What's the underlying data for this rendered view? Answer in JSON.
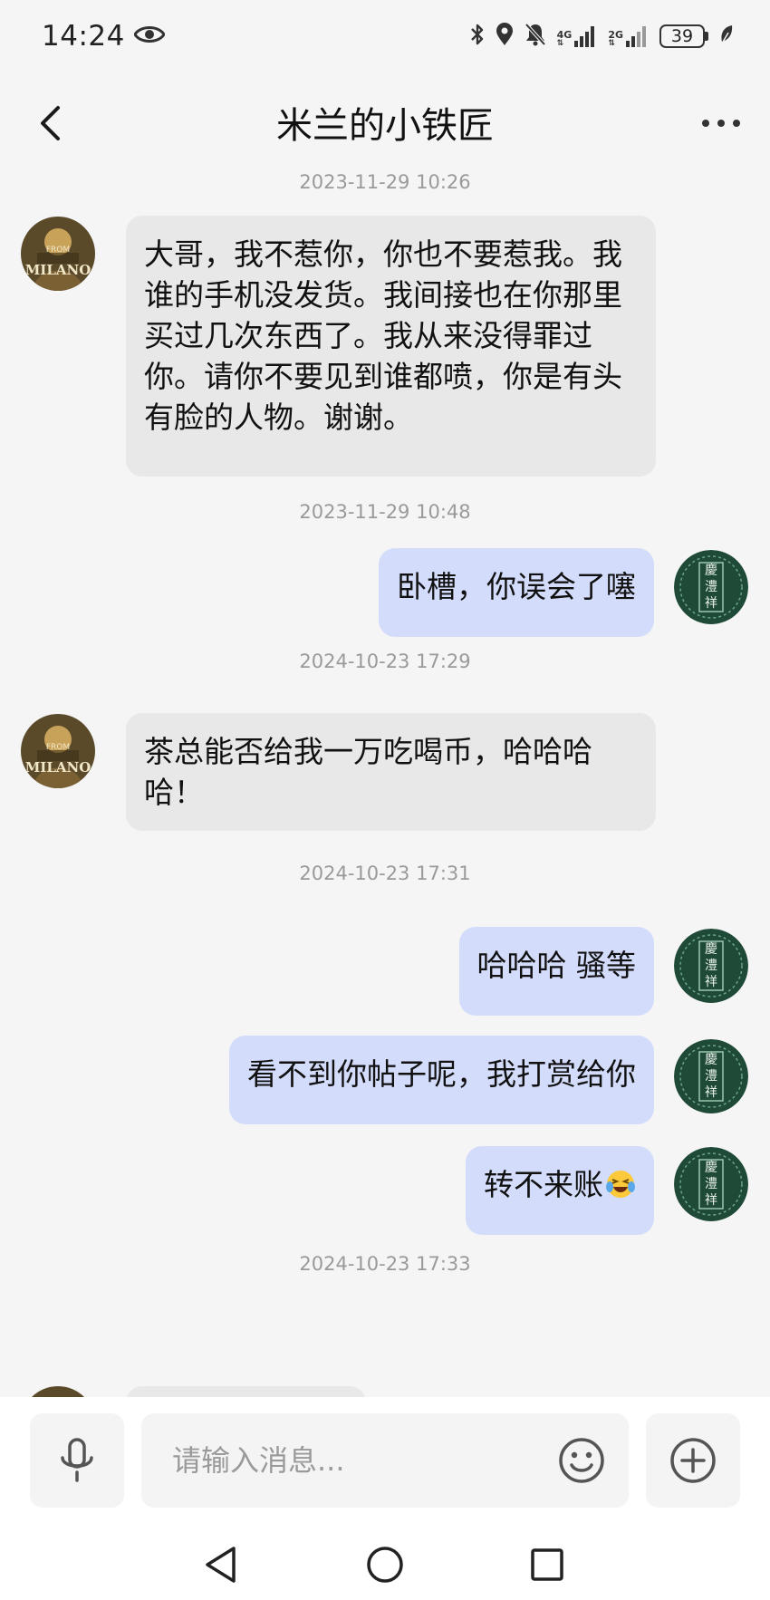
{
  "status_bar": {
    "time": "14:24",
    "net_4g": "4G",
    "net_2g": "2G",
    "battery": "39",
    "icons": [
      "eye-icon",
      "bluetooth-icon",
      "location-icon",
      "mute-icon",
      "signal-icon",
      "leaf-icon"
    ]
  },
  "header": {
    "title": "米兰的小铁匠",
    "back_icon": "chevron-left-icon",
    "more_icon": "more-dots-icon"
  },
  "messages": [
    {
      "type": "time",
      "text": "2023-11-29 10:26"
    },
    {
      "type": "in",
      "text": "大哥，我不惹你，你也不要惹我。我谁的手机没发货。我间接也在你那里买过几次东西了。我从来没得罪过你。请你不要见到谁都喷，你是有头有脸的人物。谢谢。"
    },
    {
      "type": "time",
      "text": "2023-11-29 10:48"
    },
    {
      "type": "out",
      "text": "卧槽，你误会了噻"
    },
    {
      "type": "time",
      "text": "2024-10-23 17:29"
    },
    {
      "type": "in",
      "text": "茶总能否给我一万吃喝币，哈哈哈哈！"
    },
    {
      "type": "time",
      "text": "2024-10-23 17:31"
    },
    {
      "type": "out",
      "text": "哈哈哈 骚等"
    },
    {
      "type": "out",
      "text": "看不到你帖子呢，我打赏给你"
    },
    {
      "type": "out",
      "text": "转不来账",
      "emoji": "laughing-crying-emoji"
    },
    {
      "type": "time",
      "text": "2024-10-23 17:33"
    }
  ],
  "avatars": {
    "contact": {
      "label": "MILANO",
      "sub": "FROM"
    },
    "self": {
      "label": "慶澧祥"
    }
  },
  "input": {
    "placeholder": "请输入消息..."
  },
  "colors": {
    "background": "#f5f5f5",
    "incoming_bubble": "#e8e8e8",
    "outgoing_bubble": "#d3dcfb",
    "self_avatar": "#1f4a37"
  }
}
